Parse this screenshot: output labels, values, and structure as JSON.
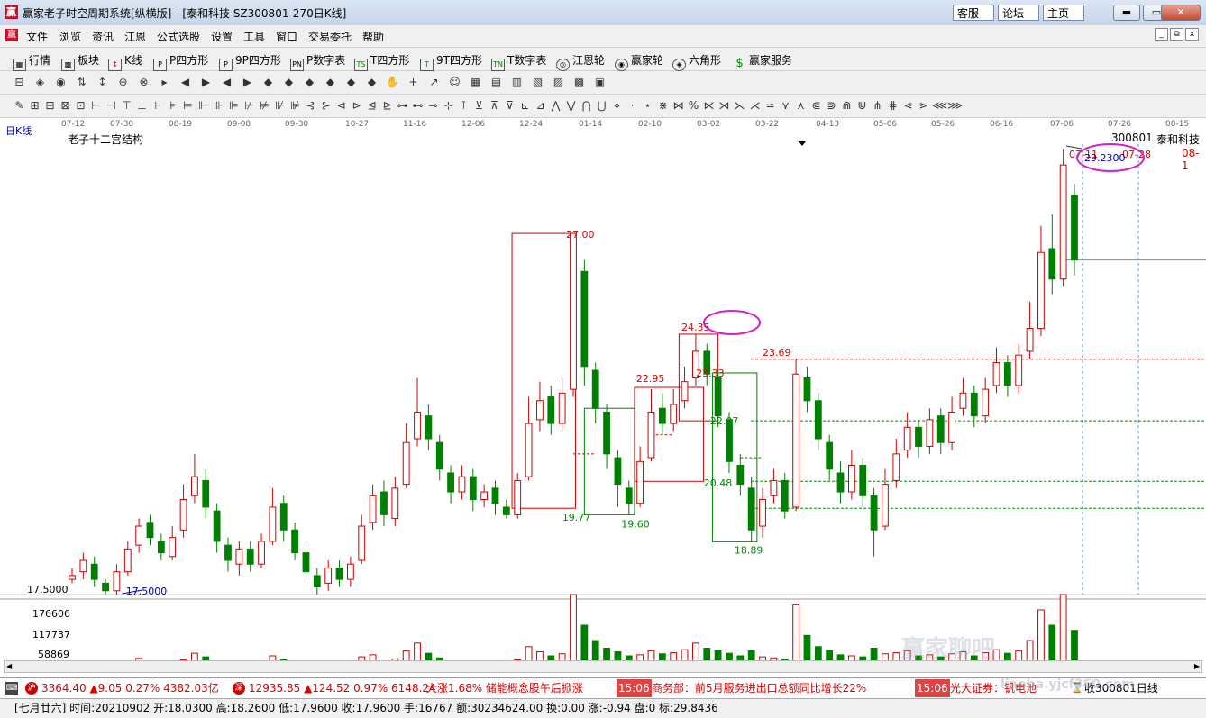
{
  "window": {
    "app_glyph": "赢",
    "title": "赢家老子时空周期系统[纵横版] - [泰和科技  SZ300801-270日K线]",
    "links": [
      "客服",
      "论坛",
      "主页"
    ],
    "controls": {
      "minimize": "▬",
      "maximize": "▭",
      "close": "✕"
    }
  },
  "menu": {
    "items": [
      "文件",
      "浏览",
      "资讯",
      "江恩",
      "公式选股",
      "设置",
      "工具",
      "窗口",
      "交易委托",
      "帮助"
    ],
    "mdi_controls": [
      "_",
      "⧉",
      "x"
    ]
  },
  "nav": {
    "items": [
      {
        "label": "行情",
        "icon": "table-icon"
      },
      {
        "label": "板块",
        "icon": "blocks-icon"
      },
      {
        "label": "K线",
        "icon": "candlestick-icon"
      },
      {
        "label": "P四方形",
        "icon": "p-square-icon"
      },
      {
        "label": "9P四方形",
        "icon": "9p-square-icon"
      },
      {
        "label": "P数字表",
        "icon": "p-number-icon"
      },
      {
        "label": "T四方形",
        "icon": "t-square-icon"
      },
      {
        "label": "9T四方形",
        "icon": "9t-square-icon"
      },
      {
        "label": "T数字表",
        "icon": "t-number-icon"
      },
      {
        "label": "江恩轮",
        "icon": "gann-wheel-icon"
      },
      {
        "label": "赢家轮",
        "icon": "winner-wheel-icon"
      },
      {
        "label": "六角形",
        "icon": "hexagon-icon"
      },
      {
        "label": "赢家服务",
        "icon": "dollar-icon"
      }
    ],
    "icon_glyphs": [
      "▦",
      "▩",
      "↕",
      "P",
      "P",
      "PN",
      "TS",
      "T",
      "TN",
      "◎",
      "◉",
      "◈",
      "$"
    ]
  },
  "toolbar_glyphs": [
    "⊟",
    "◈",
    "◉",
    "⇅",
    "↕",
    "⊕",
    "⊗",
    "▸",
    "◀",
    "▶",
    "◀",
    "▶",
    "◆",
    "◆",
    "◆",
    "◆",
    "◆",
    "◆",
    "✋",
    "+",
    "↗",
    "☺",
    "▦",
    "▤",
    "▥",
    "▧",
    "▨",
    "▩",
    "▣"
  ],
  "toolbar2_glyphs": [
    "✎",
    "⊞",
    "⊟",
    "⊠",
    "⊡",
    "⊢",
    "⊣",
    "⊤",
    "⊥",
    "⊦",
    "⊧",
    "⊨",
    "⊩",
    "⊪",
    "⊫",
    "⊬",
    "⊭",
    "⊮",
    "⊯",
    "⊰",
    "⊱",
    "⊲",
    "⊳",
    "⊴",
    "⊵",
    "⊶",
    "⊷",
    "⊸",
    "⊹",
    "⊺",
    "⊻",
    "⊼",
    "⊽",
    "⊾",
    "⊿",
    "⋀",
    "⋁",
    "⋂",
    "⋃",
    "⋄",
    "⋅",
    "⋆",
    "⋇",
    "⋈",
    "%",
    "⋉",
    "⋊",
    "⋋",
    "⋌",
    "⋍",
    "⋎",
    "⋏",
    "⋐",
    "⋑",
    "⋒",
    "⋓",
    "⋔",
    "⋕",
    "⋖",
    "⋗",
    "⋘",
    "⋙"
  ],
  "dates": [
    "07-12",
    "07-30",
    "08-19",
    "09-08",
    "09-30",
    "10-27",
    "11-16",
    "12-06",
    "12-24",
    "01-14",
    "02-10",
    "03-02",
    "03-22",
    "04-13",
    "05-06",
    "05-26",
    "06-16",
    "07-06",
    "07-26",
    "08-15"
  ],
  "chart": {
    "period_label": "日K线",
    "indicator_name": "老子十二宫结构",
    "code": "300801",
    "name": "泰和科技",
    "top_right_date": "08-1",
    "y_axis_label": "17.5000",
    "volume_ticks": [
      "176606",
      "117737",
      "58869"
    ]
  },
  "chart_data": {
    "type": "candlestick",
    "annotations": [
      {
        "text": "27.00",
        "x_date": "01-14",
        "price": 27.0
      },
      {
        "text": "24.35",
        "x_date": "03-02",
        "price": 24.35
      },
      {
        "text": "23.69",
        "x_date": "03-22",
        "price": 23.69
      },
      {
        "text": "23.33",
        "x_date": "03-02",
        "price": 23.33
      },
      {
        "text": "22.95",
        "x_date": "02-10",
        "price": 22.95
      },
      {
        "text": "22.07",
        "x_date": "03-02",
        "price": 22.07
      },
      {
        "text": "20.48",
        "x_date": "03-02",
        "price": 20.48
      },
      {
        "text": "19.77",
        "x_date": "01-14",
        "price": 19.77
      },
      {
        "text": "19.60",
        "x_date": "02-10",
        "price": 19.6
      },
      {
        "text": "18.89",
        "x_date": "03-22",
        "price": 18.89
      },
      {
        "text": "17.5000",
        "x_date": "07-30",
        "price": 17.5
      },
      {
        "text": "29.2300",
        "x_date": "07-06",
        "price": 29.23
      },
      {
        "text": "07-11",
        "x_date": "07-06"
      },
      {
        "text": "07-28",
        "x_date": "07-26"
      }
    ],
    "candles_approx": [
      {
        "i": 0,
        "o": 17.9,
        "c": 18.0,
        "h": 18.2,
        "l": 17.8
      },
      {
        "i": 1,
        "o": 18.1,
        "c": 18.4,
        "h": 18.6,
        "l": 17.9
      },
      {
        "i": 2,
        "o": 18.3,
        "c": 17.9,
        "h": 18.5,
        "l": 17.7
      },
      {
        "i": 3,
        "o": 17.8,
        "c": 17.6,
        "h": 17.9,
        "l": 17.5
      },
      {
        "i": 4,
        "o": 17.6,
        "c": 18.1,
        "h": 18.3,
        "l": 17.5
      },
      {
        "i": 5,
        "o": 18.1,
        "c": 18.7,
        "h": 18.9,
        "l": 18.0
      },
      {
        "i": 6,
        "o": 18.8,
        "c": 19.3,
        "h": 19.5,
        "l": 18.6
      },
      {
        "i": 7,
        "o": 19.4,
        "c": 19.0,
        "h": 19.6,
        "l": 18.8
      },
      {
        "i": 8,
        "o": 18.9,
        "c": 18.6,
        "h": 19.1,
        "l": 18.4
      },
      {
        "i": 9,
        "o": 18.5,
        "c": 19.0,
        "h": 19.3,
        "l": 18.4
      },
      {
        "i": 10,
        "o": 19.2,
        "c": 20.0,
        "h": 20.4,
        "l": 19.0
      },
      {
        "i": 11,
        "o": 20.1,
        "c": 20.6,
        "h": 21.2,
        "l": 19.9
      },
      {
        "i": 12,
        "o": 20.5,
        "c": 19.8,
        "h": 20.8,
        "l": 19.5
      },
      {
        "i": 13,
        "o": 19.7,
        "c": 18.9,
        "h": 19.9,
        "l": 18.6
      },
      {
        "i": 14,
        "o": 18.8,
        "c": 18.4,
        "h": 19.0,
        "l": 18.1
      },
      {
        "i": 15,
        "o": 18.3,
        "c": 18.7,
        "h": 18.9,
        "l": 18.0
      },
      {
        "i": 16,
        "o": 18.7,
        "c": 18.3,
        "h": 18.9,
        "l": 18.1
      },
      {
        "i": 17,
        "o": 18.3,
        "c": 18.9,
        "h": 19.1,
        "l": 18.2
      },
      {
        "i": 18,
        "o": 18.9,
        "c": 19.8,
        "h": 20.3,
        "l": 18.8
      },
      {
        "i": 19,
        "o": 19.9,
        "c": 19.2,
        "h": 20.1,
        "l": 18.9
      },
      {
        "i": 20,
        "o": 19.2,
        "c": 18.6,
        "h": 19.4,
        "l": 18.4
      },
      {
        "i": 21,
        "o": 18.6,
        "c": 18.1,
        "h": 18.8,
        "l": 17.9
      },
      {
        "i": 22,
        "o": 18.0,
        "c": 17.7,
        "h": 18.2,
        "l": 17.5
      },
      {
        "i": 23,
        "o": 17.8,
        "c": 18.2,
        "h": 18.4,
        "l": 17.6
      },
      {
        "i": 24,
        "o": 18.2,
        "c": 17.9,
        "h": 18.4,
        "l": 17.7
      },
      {
        "i": 25,
        "o": 17.9,
        "c": 18.3,
        "h": 18.5,
        "l": 17.7
      },
      {
        "i": 26,
        "o": 18.4,
        "c": 19.3,
        "h": 19.6,
        "l": 18.3
      },
      {
        "i": 27,
        "o": 19.4,
        "c": 20.1,
        "h": 20.4,
        "l": 19.2
      },
      {
        "i": 28,
        "o": 20.2,
        "c": 19.6,
        "h": 20.5,
        "l": 19.3
      },
      {
        "i": 29,
        "o": 19.5,
        "c": 20.3,
        "h": 20.6,
        "l": 19.3
      },
      {
        "i": 30,
        "o": 20.4,
        "c": 21.5,
        "h": 22.0,
        "l": 20.3
      },
      {
        "i": 31,
        "o": 21.6,
        "c": 22.3,
        "h": 23.2,
        "l": 21.4
      },
      {
        "i": 32,
        "o": 22.2,
        "c": 21.6,
        "h": 22.5,
        "l": 21.3
      },
      {
        "i": 33,
        "o": 21.5,
        "c": 20.8,
        "h": 21.7,
        "l": 20.5
      },
      {
        "i": 34,
        "o": 20.7,
        "c": 20.2,
        "h": 20.9,
        "l": 19.9
      },
      {
        "i": 35,
        "o": 20.2,
        "c": 20.6,
        "h": 20.9,
        "l": 20.0
      },
      {
        "i": 36,
        "o": 20.6,
        "c": 20.0,
        "h": 20.8,
        "l": 19.7
      },
      {
        "i": 37,
        "o": 20.0,
        "c": 20.2,
        "h": 20.4,
        "l": 19.8
      },
      {
        "i": 38,
        "o": 20.3,
        "c": 19.9,
        "h": 20.5,
        "l": 19.6
      },
      {
        "i": 39,
        "o": 19.8,
        "c": 19.6,
        "h": 20.0,
        "l": 19.5
      },
      {
        "i": 40,
        "o": 19.6,
        "c": 20.5,
        "h": 20.7,
        "l": 19.5
      },
      {
        "i": 41,
        "o": 20.6,
        "c": 22.0,
        "h": 22.7,
        "l": 20.5
      },
      {
        "i": 42,
        "o": 22.1,
        "c": 22.6,
        "h": 23.1,
        "l": 21.8
      },
      {
        "i": 43,
        "o": 22.7,
        "c": 22.0,
        "h": 23.0,
        "l": 21.7
      },
      {
        "i": 44,
        "o": 22.0,
        "c": 22.8,
        "h": 23.2,
        "l": 21.8
      },
      {
        "i": 45,
        "o": 22.9,
        "c": 27.0,
        "h": 27.0,
        "l": 22.7
      },
      {
        "i": 46,
        "o": 26.0,
        "c": 23.5,
        "h": 26.3,
        "l": 23.0
      },
      {
        "i": 47,
        "o": 23.4,
        "c": 22.4,
        "h": 23.6,
        "l": 22.0
      },
      {
        "i": 48,
        "o": 22.3,
        "c": 21.2,
        "h": 22.5,
        "l": 20.8
      },
      {
        "i": 49,
        "o": 21.1,
        "c": 20.4,
        "h": 21.3,
        "l": 19.8
      },
      {
        "i": 50,
        "o": 20.3,
        "c": 19.9,
        "h": 20.5,
        "l": 19.6
      },
      {
        "i": 51,
        "o": 19.9,
        "c": 21.0,
        "h": 21.4,
        "l": 19.8
      },
      {
        "i": 52,
        "o": 21.1,
        "c": 22.3,
        "h": 22.9,
        "l": 21.0
      },
      {
        "i": 53,
        "o": 22.4,
        "c": 22.0,
        "h": 22.8,
        "l": 21.7
      },
      {
        "i": 54,
        "o": 22.0,
        "c": 22.5,
        "h": 22.9,
        "l": 21.8
      },
      {
        "i": 55,
        "o": 22.6,
        "c": 23.1,
        "h": 23.5,
        "l": 22.4
      },
      {
        "i": 56,
        "o": 23.2,
        "c": 23.9,
        "h": 24.35,
        "l": 23.0
      },
      {
        "i": 57,
        "o": 23.9,
        "c": 23.3,
        "h": 24.1,
        "l": 23.0
      },
      {
        "i": 58,
        "o": 23.2,
        "c": 22.2,
        "h": 23.4,
        "l": 21.9
      },
      {
        "i": 59,
        "o": 22.1,
        "c": 21.0,
        "h": 22.3,
        "l": 20.7
      },
      {
        "i": 60,
        "o": 20.9,
        "c": 20.4,
        "h": 21.2,
        "l": 20.1
      },
      {
        "i": 61,
        "o": 20.3,
        "c": 19.2,
        "h": 20.6,
        "l": 18.9
      },
      {
        "i": 62,
        "o": 19.3,
        "c": 20.0,
        "h": 20.3,
        "l": 19.0
      },
      {
        "i": 63,
        "o": 20.1,
        "c": 20.5,
        "h": 20.8,
        "l": 19.9
      },
      {
        "i": 64,
        "o": 20.5,
        "c": 19.7,
        "h": 20.7,
        "l": 19.5
      },
      {
        "i": 65,
        "o": 19.8,
        "c": 23.3,
        "h": 23.69,
        "l": 19.7
      },
      {
        "i": 66,
        "o": 23.2,
        "c": 22.6,
        "h": 23.5,
        "l": 22.3
      },
      {
        "i": 67,
        "o": 22.6,
        "c": 21.6,
        "h": 22.8,
        "l": 21.3
      },
      {
        "i": 68,
        "o": 21.5,
        "c": 20.8,
        "h": 21.7,
        "l": 20.5
      },
      {
        "i": 69,
        "o": 20.7,
        "c": 20.2,
        "h": 21.0,
        "l": 19.9
      },
      {
        "i": 70,
        "o": 20.2,
        "c": 20.9,
        "h": 21.3,
        "l": 20.0
      },
      {
        "i": 71,
        "o": 20.9,
        "c": 20.1,
        "h": 21.1,
        "l": 19.8
      },
      {
        "i": 72,
        "o": 20.1,
        "c": 19.2,
        "h": 20.3,
        "l": 18.5
      },
      {
        "i": 73,
        "o": 19.3,
        "c": 20.4,
        "h": 20.8,
        "l": 19.2
      },
      {
        "i": 74,
        "o": 20.5,
        "c": 21.2,
        "h": 21.6,
        "l": 20.3
      },
      {
        "i": 75,
        "o": 21.3,
        "c": 21.9,
        "h": 22.3,
        "l": 21.1
      },
      {
        "i": 76,
        "o": 21.9,
        "c": 21.4,
        "h": 22.1,
        "l": 21.1
      },
      {
        "i": 77,
        "o": 21.4,
        "c": 22.1,
        "h": 22.4,
        "l": 21.2
      },
      {
        "i": 78,
        "o": 22.2,
        "c": 21.5,
        "h": 22.4,
        "l": 21.2
      },
      {
        "i": 79,
        "o": 21.5,
        "c": 22.3,
        "h": 22.7,
        "l": 21.3
      },
      {
        "i": 80,
        "o": 22.4,
        "c": 22.8,
        "h": 23.2,
        "l": 22.2
      },
      {
        "i": 81,
        "o": 22.8,
        "c": 22.2,
        "h": 23.0,
        "l": 21.9
      },
      {
        "i": 82,
        "o": 22.2,
        "c": 22.9,
        "h": 23.2,
        "l": 22.0
      },
      {
        "i": 83,
        "o": 23.0,
        "c": 23.6,
        "h": 24.0,
        "l": 22.8
      },
      {
        "i": 84,
        "o": 23.6,
        "c": 23.0,
        "h": 23.8,
        "l": 22.7
      },
      {
        "i": 85,
        "o": 23.0,
        "c": 23.8,
        "h": 24.1,
        "l": 22.8
      },
      {
        "i": 86,
        "o": 23.9,
        "c": 24.5,
        "h": 25.2,
        "l": 23.7
      },
      {
        "i": 87,
        "o": 24.5,
        "c": 26.5,
        "h": 27.2,
        "l": 24.3
      },
      {
        "i": 88,
        "o": 26.6,
        "c": 25.8,
        "h": 27.5,
        "l": 25.4
      },
      {
        "i": 89,
        "o": 25.8,
        "c": 28.8,
        "h": 29.23,
        "l": 25.6
      },
      {
        "i": 90,
        "o": 28.0,
        "c": 26.3,
        "h": 28.3,
        "l": 25.9
      }
    ],
    "volume_approx": [
      12,
      10,
      14,
      9,
      11,
      18,
      25,
      16,
      12,
      10,
      22,
      35,
      28,
      18,
      15,
      13,
      12,
      14,
      30,
      22,
      17,
      13,
      11,
      12,
      10,
      14,
      28,
      32,
      20,
      24,
      40,
      55,
      35,
      26,
      20,
      18,
      16,
      15,
      14,
      12,
      22,
      48,
      38,
      30,
      34,
      150,
      90,
      60,
      45,
      38,
      30,
      32,
      40,
      34,
      36,
      42,
      55,
      45,
      40,
      35,
      30,
      40,
      28,
      26,
      24,
      130,
      70,
      48,
      40,
      32,
      30,
      28,
      45,
      34,
      36,
      40,
      30,
      32,
      28,
      34,
      38,
      30,
      36,
      42,
      35,
      40,
      60,
      120,
      90,
      150,
      80
    ]
  },
  "ticker": {
    "index1": "3364.40 ▲9.05 0.27% 4382.03亿",
    "index2": "12935.85 ▲124.52 0.97% 6148.24",
    "news1": "大涨1.68% 储能概念股午后掀涨",
    "time1": "15:06",
    "news2": "商务部：前5月服务进出口总额同比增长22%",
    "time2": "15:06",
    "news3": "光大证券：钒电池",
    "right": "收300801日线"
  },
  "status_bar": "[七月廿六] 时间:20210902 开:18.0300 高:18.2600 低:17.9600 收:17.9600 手:16767 额:30234624.00 换:0.00 涨:-0.94 盘:0 标:29.8436",
  "watermark": "赢家聊吧",
  "watermark_url": "liaoba.yjcf360.com",
  "colors": {
    "up": "#d00000",
    "down": "#008000",
    "green_box": "#008000",
    "red_box": "#d00000",
    "highlight": "#d020d0",
    "dashed_blue": "#6699dd"
  }
}
